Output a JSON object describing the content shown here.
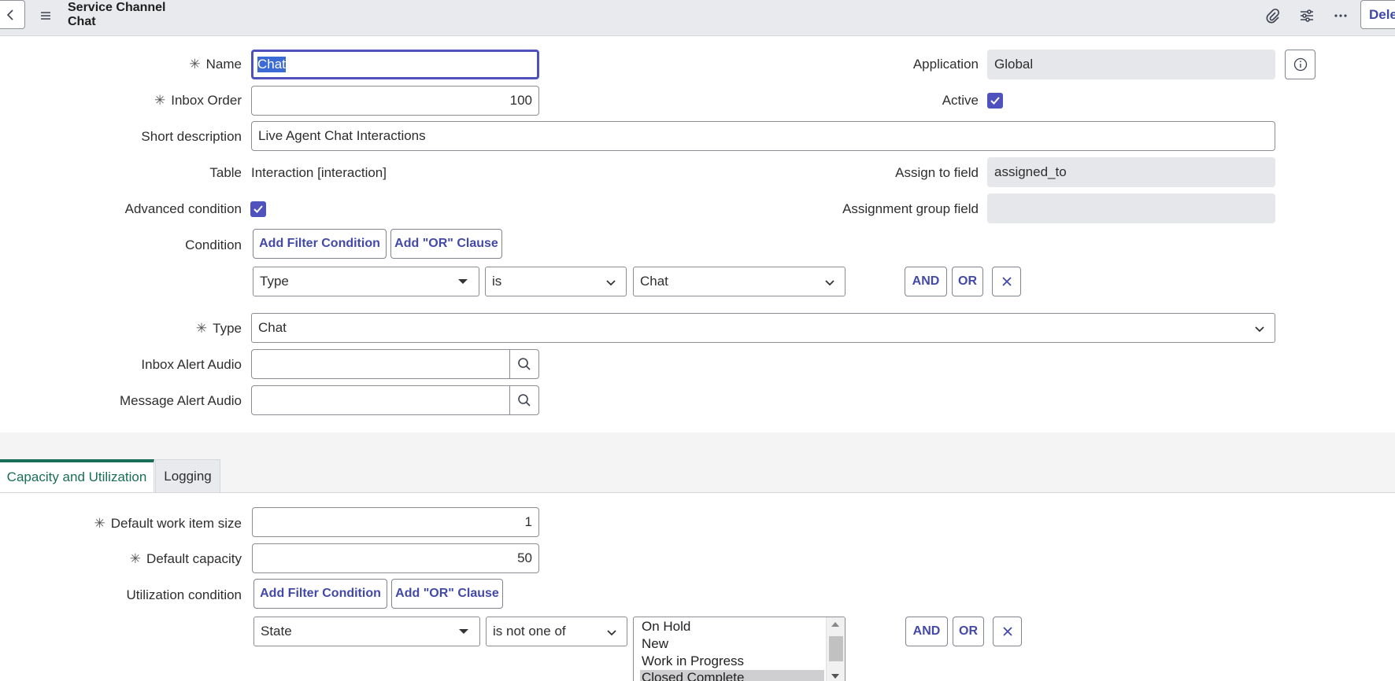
{
  "header": {
    "title_line1": "Service Channel",
    "title_line2": "Chat",
    "delete_label": "Dele",
    "icons": [
      "back-icon",
      "menu-icon",
      "paperclip-icon",
      "settings-sliders-icon",
      "more-icon"
    ]
  },
  "form": {
    "name": {
      "label": "Name",
      "value": "Chat"
    },
    "inbox_order": {
      "label": "Inbox Order",
      "value": "100"
    },
    "short_description": {
      "label": "Short description",
      "value": "Live Agent Chat Interactions"
    },
    "table": {
      "label": "Table",
      "value": "Interaction [interaction]"
    },
    "advanced_condition": {
      "label": "Advanced condition",
      "checked": true
    },
    "condition": {
      "label": "Condition",
      "add_filter_label": "Add Filter Condition",
      "add_or_label": "Add \"OR\" Clause",
      "field": "Type",
      "operator": "is",
      "value": "Chat",
      "and_label": "AND",
      "or_label": "OR"
    },
    "type": {
      "label": "Type",
      "value": "Chat"
    },
    "inbox_alert_audio": {
      "label": "Inbox Alert Audio",
      "value": ""
    },
    "message_alert_audio": {
      "label": "Message Alert Audio",
      "value": ""
    },
    "application": {
      "label": "Application",
      "value": "Global"
    },
    "active": {
      "label": "Active",
      "checked": true
    },
    "assign_to_field": {
      "label": "Assign to field",
      "value": "assigned_to"
    },
    "assignment_group_field": {
      "label": "Assignment group field",
      "value": ""
    }
  },
  "tabs": [
    {
      "label": "Capacity and Utilization",
      "active": true
    },
    {
      "label": "Logging",
      "active": false
    }
  ],
  "capacity": {
    "default_work_item_size": {
      "label": "Default work item size",
      "value": "1"
    },
    "default_capacity": {
      "label": "Default capacity",
      "value": "50"
    },
    "utilization_condition": {
      "label": "Utilization condition",
      "add_filter_label": "Add Filter Condition",
      "add_or_label": "Add \"OR\" Clause",
      "field": "State",
      "operator": "is not one of",
      "options": [
        "On Hold",
        "New",
        "Work in Progress",
        "Closed Complete"
      ],
      "and_label": "AND",
      "or_label": "OR"
    }
  },
  "colors": {
    "accent": "#4f52bd",
    "tab_active": "#1a6e57",
    "header_bg": "#e9eaee",
    "readonly_bg": "#e6e7eb"
  }
}
